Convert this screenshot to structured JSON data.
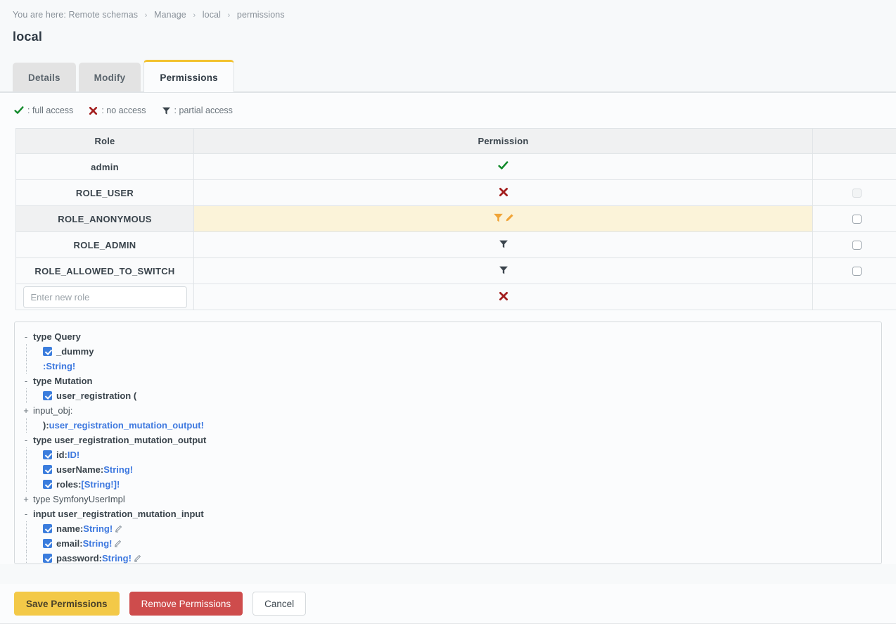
{
  "breadcrumb": {
    "prefix": "You are here:",
    "items": [
      "Remote schemas",
      "Manage",
      "local",
      "permissions"
    ],
    "separator": "›"
  },
  "page_title": "local",
  "tabs": [
    {
      "label": "Details",
      "active": false
    },
    {
      "label": "Modify",
      "active": false
    },
    {
      "label": "Permissions",
      "active": true
    }
  ],
  "legend": [
    {
      "icon": "check-icon",
      "label": ": full access"
    },
    {
      "icon": "cross-icon",
      "label": ": no access"
    },
    {
      "icon": "filter-icon",
      "label": ": partial access"
    }
  ],
  "permission_table": {
    "headers": [
      "Role",
      "Permission",
      ""
    ],
    "rows": [
      {
        "role": "admin",
        "permission": "full",
        "icon": "check-icon",
        "checkbox": "none",
        "highlight": false
      },
      {
        "role": "ROLE_USER",
        "permission": "none",
        "icon": "cross-icon",
        "checkbox": "disabled",
        "highlight": false
      },
      {
        "role": "ROLE_ANONYMOUS",
        "permission": "partial",
        "icon": "filter-edit-icon",
        "checkbox": "enabled",
        "highlight": true
      },
      {
        "role": "ROLE_ADMIN",
        "permission": "partial",
        "icon": "filter-icon",
        "checkbox": "enabled",
        "highlight": false
      },
      {
        "role": "ROLE_ALLOWED_TO_SWITCH",
        "permission": "partial",
        "icon": "filter-icon",
        "checkbox": "enabled",
        "highlight": false
      }
    ],
    "new_role_row": {
      "input_value": "",
      "input_placeholder": "Enter new role",
      "permission": "none",
      "icon": "cross-icon"
    }
  },
  "schema_tree": [
    {
      "toggle": "-",
      "depth": 0,
      "checkbox": false,
      "label": "type Query",
      "bold": true,
      "type_ref": "",
      "pencil": false
    },
    {
      "toggle": "",
      "depth": 1,
      "checkbox": true,
      "label": "_dummy",
      "bold": true,
      "type_ref": "",
      "pencil": false
    },
    {
      "toggle": "",
      "depth": 1,
      "checkbox": false,
      "label": "",
      "bold": true,
      "type_ref": ":String!",
      "pencil": false
    },
    {
      "toggle": "-",
      "depth": 0,
      "checkbox": false,
      "label": "type Mutation",
      "bold": true,
      "type_ref": "",
      "pencil": false
    },
    {
      "toggle": "",
      "depth": 1,
      "checkbox": true,
      "label": "user_registration (",
      "bold": true,
      "type_ref": "",
      "pencil": false
    },
    {
      "toggle": "+",
      "depth": 0,
      "checkbox": false,
      "label": "input_obj:",
      "bold": false,
      "type_ref": "",
      "pencil": false
    },
    {
      "toggle": "",
      "depth": 1,
      "checkbox": false,
      "label": "):",
      "bold": true,
      "type_ref": "user_registration_mutation_output!",
      "pencil": false
    },
    {
      "toggle": "-",
      "depth": 0,
      "checkbox": false,
      "label": "type user_registration_mutation_output",
      "bold": true,
      "type_ref": "",
      "pencil": false
    },
    {
      "toggle": "",
      "depth": 1,
      "checkbox": true,
      "label": "id:",
      "bold": true,
      "type_ref": "ID!",
      "pencil": false
    },
    {
      "toggle": "",
      "depth": 1,
      "checkbox": true,
      "label": "userName:",
      "bold": true,
      "type_ref": "String!",
      "pencil": false
    },
    {
      "toggle": "",
      "depth": 1,
      "checkbox": true,
      "label": "roles:",
      "bold": true,
      "type_ref": "[String!]!",
      "pencil": false
    },
    {
      "toggle": "+",
      "depth": 0,
      "checkbox": false,
      "label": "type SymfonyUserImpl",
      "bold": false,
      "type_ref": "",
      "pencil": false
    },
    {
      "toggle": "-",
      "depth": 0,
      "checkbox": false,
      "label": "input user_registration_mutation_input",
      "bold": true,
      "type_ref": "",
      "pencil": false
    },
    {
      "toggle": "",
      "depth": 1,
      "checkbox": true,
      "label": "name:",
      "bold": true,
      "type_ref": "String!",
      "pencil": true
    },
    {
      "toggle": "",
      "depth": 1,
      "checkbox": true,
      "label": "email:",
      "bold": true,
      "type_ref": "String!",
      "pencil": true
    },
    {
      "toggle": "",
      "depth": 1,
      "checkbox": true,
      "label": "password:",
      "bold": true,
      "type_ref": "String!",
      "pencil": true
    }
  ],
  "footer": {
    "save_label": "Save Permissions",
    "remove_label": "Remove Permissions",
    "cancel_label": "Cancel"
  },
  "colors": {
    "accent_yellow": "#f3c948",
    "danger_red": "#ce4c4c",
    "full_access_green": "#128a2b",
    "no_access_red": "#a31f1f",
    "partial_orange": "#f0a437",
    "highlight_row": "#fbf3d9",
    "type_ref_blue": "#3d78df"
  }
}
